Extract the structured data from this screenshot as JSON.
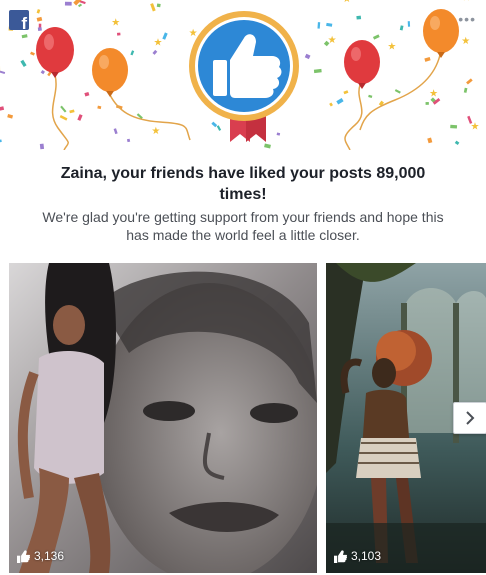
{
  "header": {
    "logo_icon": "facebook-logo-icon",
    "logo_glyph": "f",
    "more_glyph": "•••",
    "more_icon": "more-options-icon"
  },
  "banner": {
    "badge_icon": "thumbs-up-icon",
    "decorations": [
      "balloon-icon",
      "confetti",
      "ribbon"
    ],
    "colors": {
      "badge_ring": "#f0b24a",
      "badge_fill": "#2d88d6",
      "ribbon": "#d93e4f",
      "balloon_red": "#e03a3e",
      "balloon_orange": "#f38a2b"
    }
  },
  "message": {
    "headline": "Zaina, your friends have liked your posts 89,000 times!",
    "subline": "We're glad you're getting support from your friends and hope this has made the world feel a little closer."
  },
  "photos": [
    {
      "like_icon": "like-icon",
      "likes": "3,136"
    },
    {
      "like_icon": "like-icon",
      "likes": "3,103"
    }
  ],
  "carousel": {
    "next_icon": "chevron-right-icon"
  }
}
